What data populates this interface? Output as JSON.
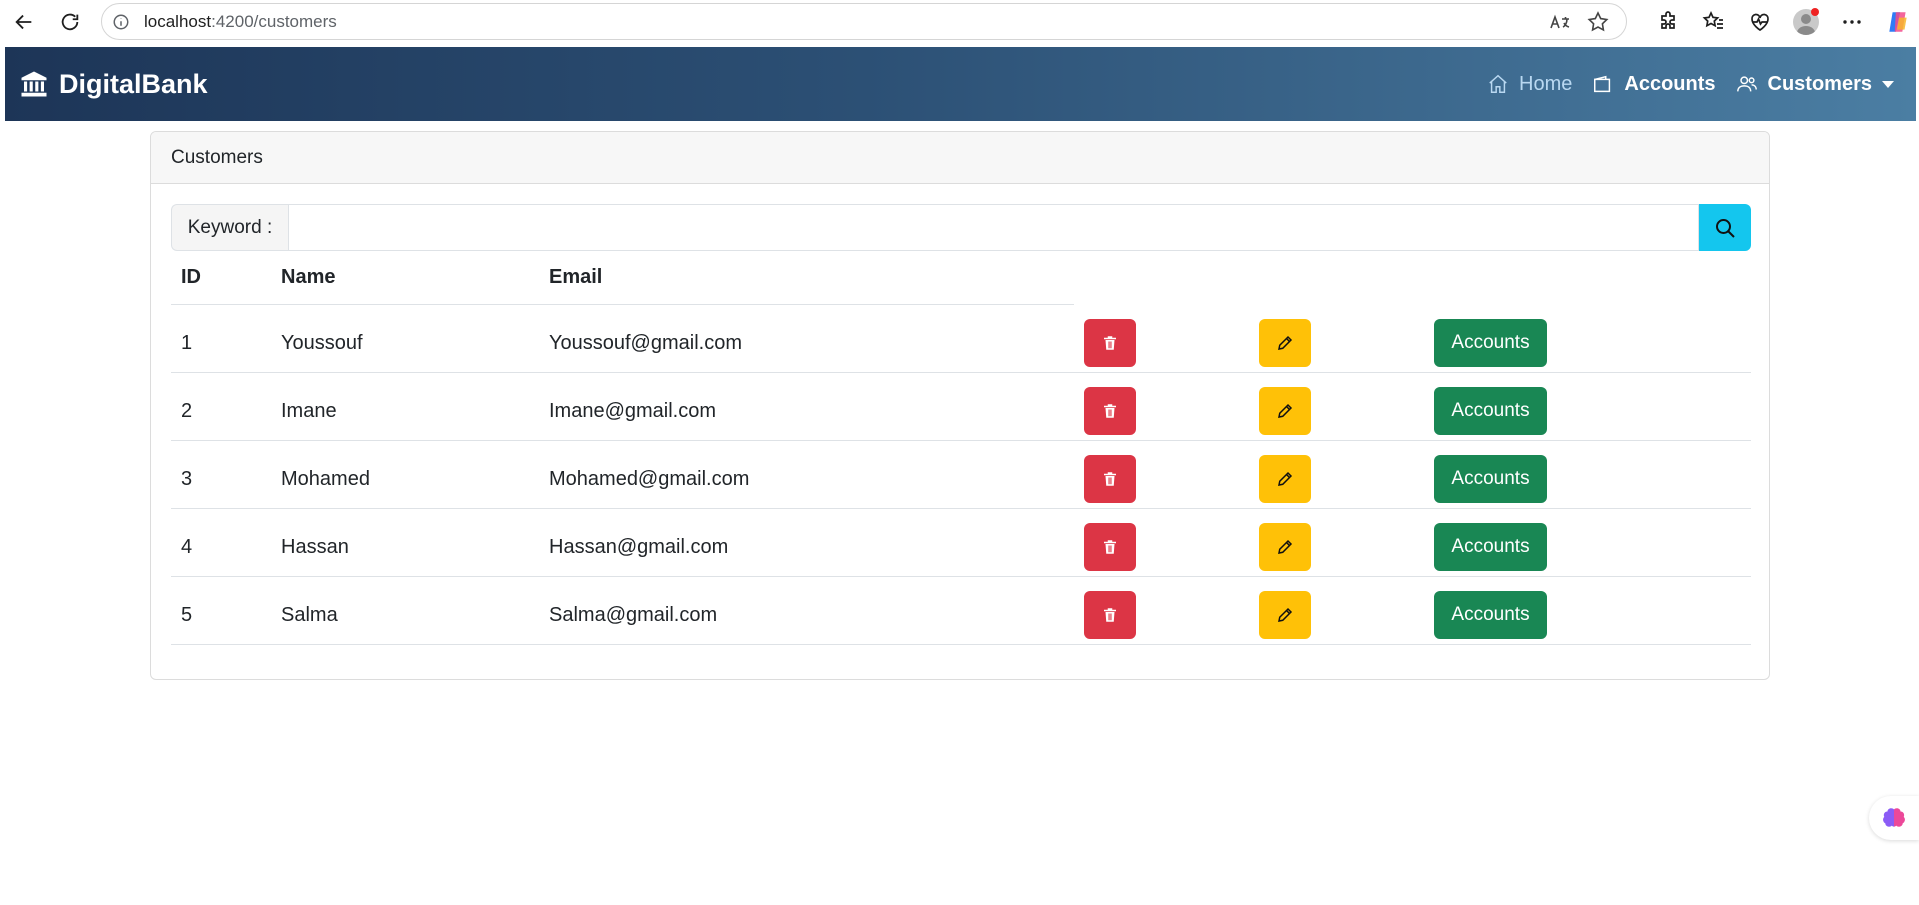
{
  "browser": {
    "url_host": "localhost",
    "url_path": ":4200/customers"
  },
  "navbar": {
    "brand": "DigitalBank",
    "links": [
      {
        "label": "Home",
        "icon": "house-icon"
      },
      {
        "label": "Accounts",
        "icon": "wallet-icon"
      },
      {
        "label": "Customers",
        "icon": "people-icon"
      }
    ]
  },
  "card": {
    "header": "Customers",
    "search": {
      "label": "Keyword :",
      "value": "",
      "button_icon": "search-icon"
    },
    "table": {
      "columns": [
        "ID",
        "Name",
        "Email"
      ],
      "rows": [
        {
          "id": "1",
          "name": "Youssouf",
          "email": "Youssouf@gmail.com",
          "accounts_label": "Accounts"
        },
        {
          "id": "2",
          "name": "Imane",
          "email": "Imane@gmail.com",
          "accounts_label": "Accounts"
        },
        {
          "id": "3",
          "name": "Mohamed",
          "email": "Mohamed@gmail.com",
          "accounts_label": "Accounts"
        },
        {
          "id": "4",
          "name": "Hassan",
          "email": "Hassan@gmail.com",
          "accounts_label": "Accounts"
        },
        {
          "id": "5",
          "name": "Salma",
          "email": "Salma@gmail.com",
          "accounts_label": "Accounts"
        }
      ]
    }
  },
  "colors": {
    "danger": "#dc3545",
    "warning": "#ffc107",
    "success": "#198754",
    "info": "#14c6ee",
    "navbar_start": "#1d3557",
    "navbar_end": "#4b7ea3"
  }
}
